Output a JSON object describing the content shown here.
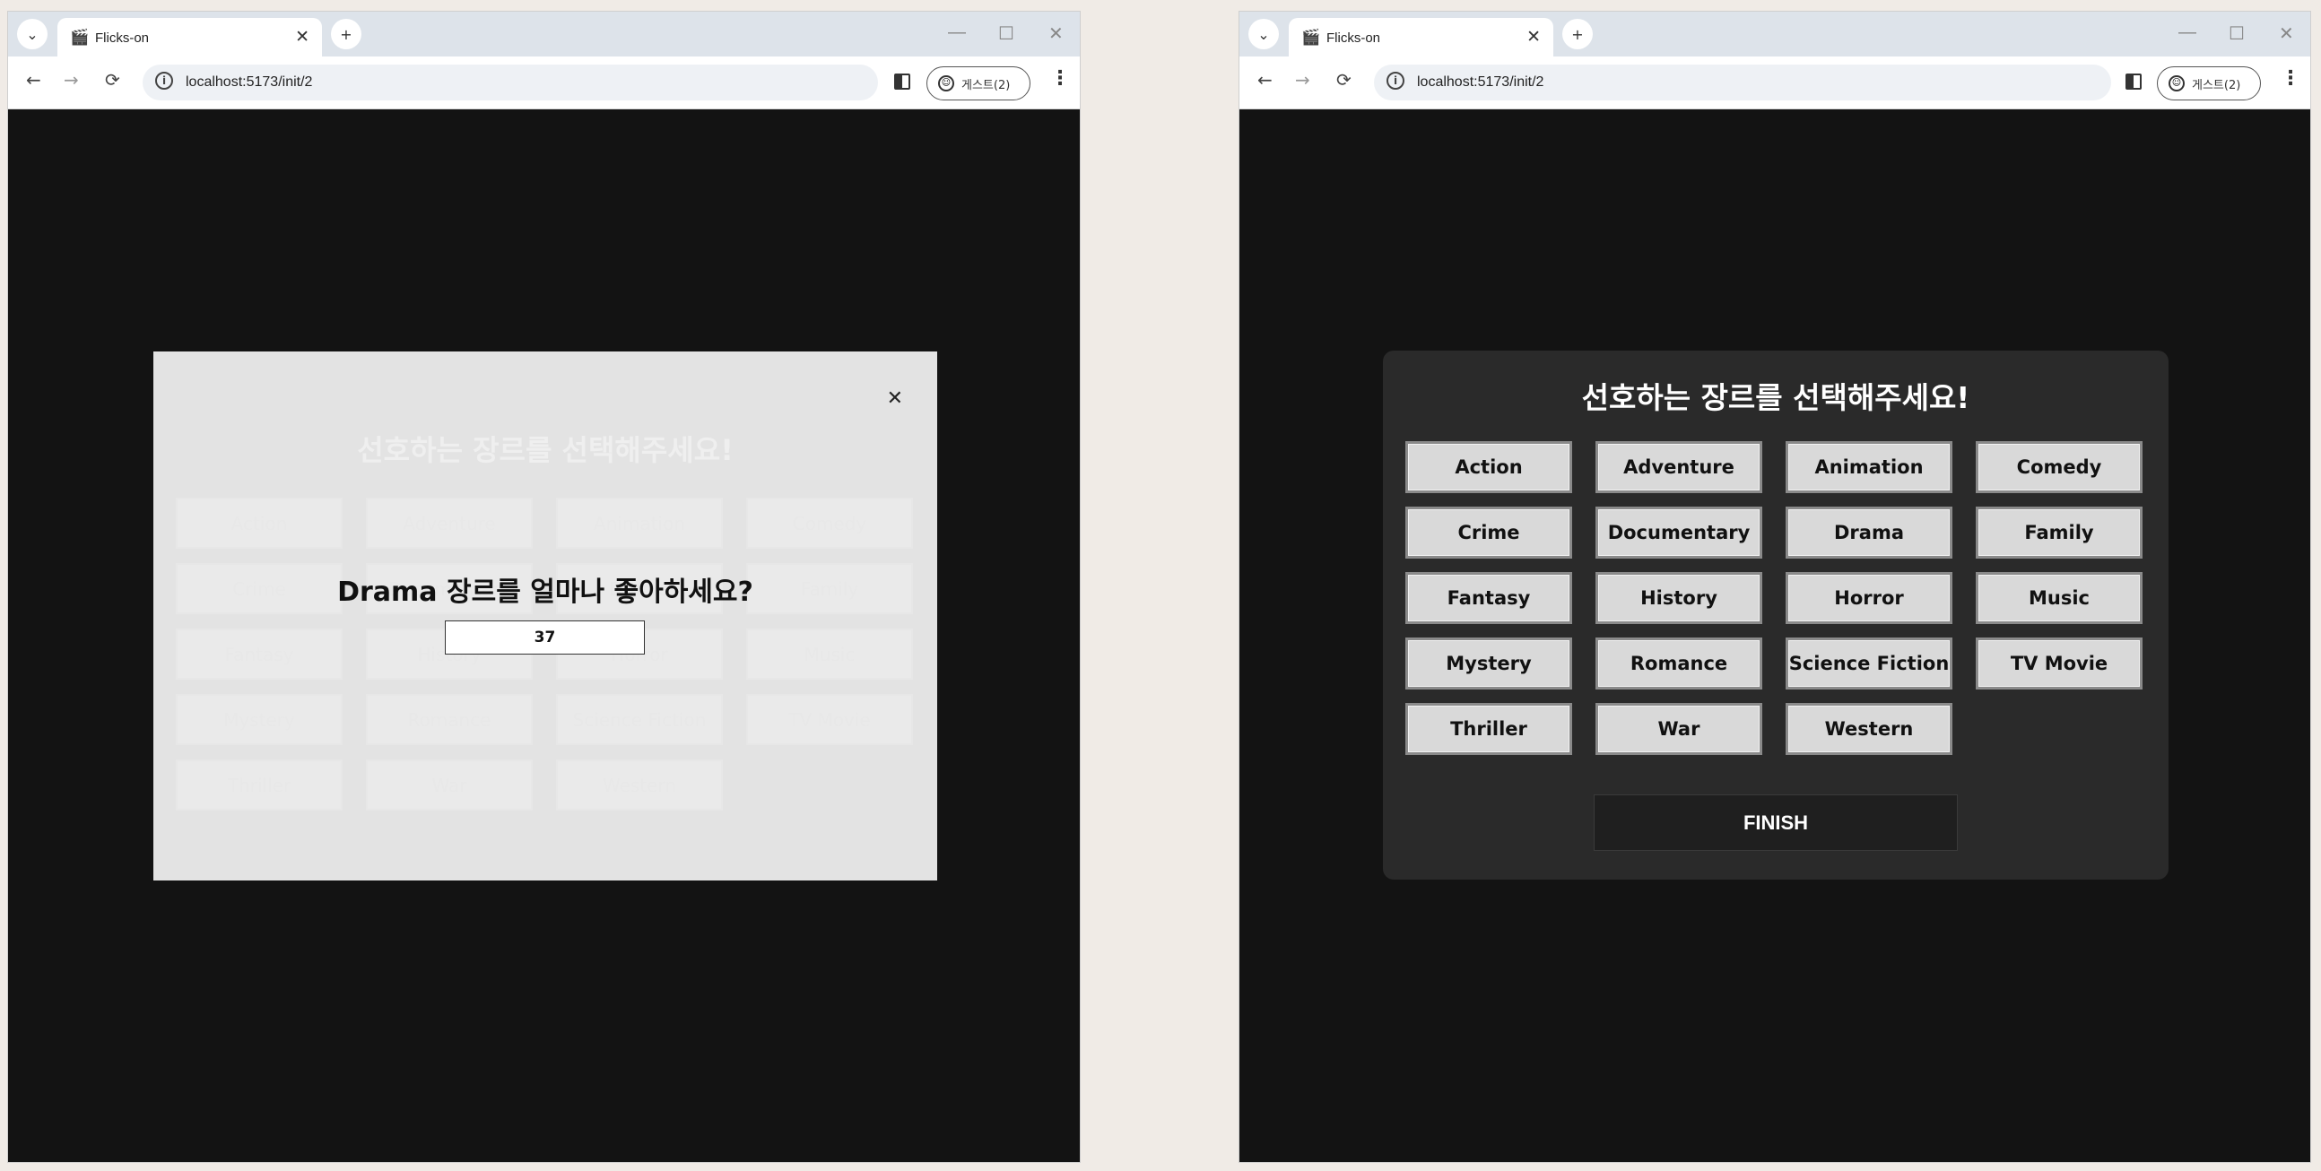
{
  "browser": {
    "tab_title": "Flicks-on",
    "url": "localhost:5173/init/2",
    "profile_label": "게스트(2)"
  },
  "icons": {
    "tab_list": "⌄",
    "favicon": "🎬",
    "tab_close": "✕",
    "new_tab": "+",
    "minimize": "—",
    "maximize": "☐",
    "window_close": "✕",
    "back": "←",
    "forward": "→",
    "reload": "⟳",
    "info": "i",
    "menu": "⋮",
    "modal_close": "✕"
  },
  "left_window": {
    "modal": {
      "faded_title": "선호하는 장르를 선택해주세요!",
      "question": "Drama 장르를 얼마나 좋아하세요?",
      "score_value": "37",
      "genres": [
        "Action",
        "Adventure",
        "Animation",
        "Comedy",
        "Crime",
        "Documentary",
        "Drama",
        "Family",
        "Fantasy",
        "History",
        "Horror",
        "Music",
        "Mystery",
        "Romance",
        "Science Fiction",
        "TV Movie",
        "Thriller",
        "War",
        "Western"
      ]
    }
  },
  "right_window": {
    "panel": {
      "title": "선호하는 장르를 선택해주세요!",
      "genres": [
        "Action",
        "Adventure",
        "Animation",
        "Comedy",
        "Crime",
        "Documentary",
        "Drama",
        "Family",
        "Fantasy",
        "History",
        "Horror",
        "Music",
        "Mystery",
        "Romance",
        "Science Fiction",
        "TV Movie",
        "Thriller",
        "War",
        "Western"
      ],
      "finish_label": "FINISH"
    }
  }
}
